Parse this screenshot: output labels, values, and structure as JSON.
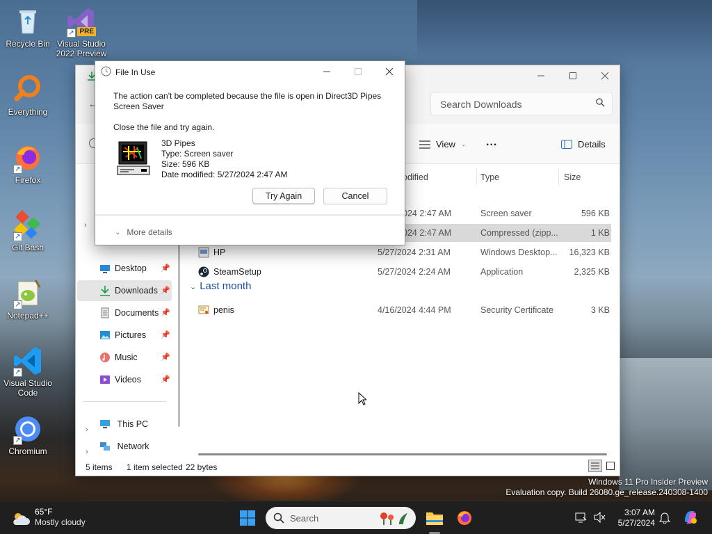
{
  "desktop": {
    "icons": [
      {
        "label": "Recycle Bin"
      },
      {
        "label": "Visual Studio 2022 Preview",
        "badge": "PRE"
      },
      {
        "label": "Everything"
      },
      {
        "label": "Firefox"
      },
      {
        "label": "Git Bash"
      },
      {
        "label": "Notepad++"
      },
      {
        "label": "Visual Studio Code"
      },
      {
        "label": "Chromium"
      }
    ]
  },
  "explorer": {
    "search_placeholder": "Search Downloads",
    "command_bar": {
      "view": "View",
      "more": "...",
      "details": "Details"
    },
    "columns": {
      "modified": "odified",
      "type": "Type",
      "size": "Size"
    },
    "nav": {
      "quick": [
        {
          "label": "Desktop",
          "icon": "desktop-icon"
        },
        {
          "label": "Downloads",
          "icon": "downloads-icon",
          "selected": true
        },
        {
          "label": "Documents",
          "icon": "documents-icon"
        },
        {
          "label": "Pictures",
          "icon": "pictures-icon"
        },
        {
          "label": "Music",
          "icon": "music-icon"
        },
        {
          "label": "Videos",
          "icon": "videos-icon"
        }
      ],
      "this_pc": "This PC",
      "network": "Network"
    },
    "rows_partial": [
      {
        "date": "024 2:47 AM",
        "type": "Screen saver",
        "size": "596 KB"
      },
      {
        "date": "024 2:47 AM",
        "type": "Compressed (zipp...",
        "size": "1 KB",
        "selected": true
      }
    ],
    "rows": [
      {
        "name": "HP",
        "date": "5/27/2024 2:31 AM",
        "type": "Windows Desktop...",
        "size": "16,323 KB"
      },
      {
        "name": "SteamSetup",
        "date": "5/27/2024 2:24 AM",
        "type": "Application",
        "size": "2,325 KB"
      }
    ],
    "group_last_month": "Last month",
    "rows_last_month": [
      {
        "name": "penis",
        "date": "4/16/2024 4:44 PM",
        "type": "Security Certificate",
        "size": "3 KB"
      }
    ],
    "status": {
      "items": "5 items",
      "selected": "1 item selected",
      "bytes": "22 bytes"
    }
  },
  "dialog": {
    "title": "File In Use",
    "message": "The action can't be completed because the file is open in Direct3D Pipes Screen Saver",
    "instruction": "Close the file and try again.",
    "file": {
      "name": "3D Pipes",
      "type": "Type: Screen saver",
      "size": "Size: 596 KB",
      "modified": "Date modified: 5/27/2024 2:47 AM"
    },
    "buttons": {
      "try_again": "Try Again",
      "cancel": "Cancel"
    },
    "more_details": "More details"
  },
  "watermark": {
    "line1": "Windows 11 Pro Insider Preview",
    "line2": "Evaluation copy. Build 26080.ge_release.240308-1400"
  },
  "taskbar": {
    "weather": {
      "temp": "65°F",
      "condition": "Mostly cloudy"
    },
    "search_label": "Search",
    "clock": {
      "time": "3:07 AM",
      "date": "5/27/2024"
    }
  }
}
